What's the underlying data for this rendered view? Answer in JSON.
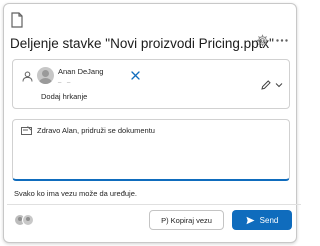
{
  "dialog": {
    "title": "Deljenje stavke \"Novi proizvodi Pricing.pptx\""
  },
  "recipients": {
    "chips": [
      {
        "name": "Anan DeJang",
        "subtext": "_ _"
      }
    ],
    "add_more_label": "Dodaj hrkanje"
  },
  "message": {
    "text": "Zdravo Alan, pridruži se dokumentu"
  },
  "access": {
    "text": "Svako ko ima vezu može da uređuje."
  },
  "actions": {
    "copy_link_label": "P) Kopiraj vezu",
    "send_label": "Send"
  },
  "colors": {
    "accent": "#0f6cbd",
    "border": "#d1d1d1"
  },
  "icons": [
    "file-icon",
    "settings-gear-icon",
    "more-options-icon",
    "person-icon",
    "remove-recipient-icon",
    "edit-pencil-icon",
    "chevron-down-icon",
    "message-icon",
    "shared-people-icon",
    "send-arrow-icon"
  ]
}
